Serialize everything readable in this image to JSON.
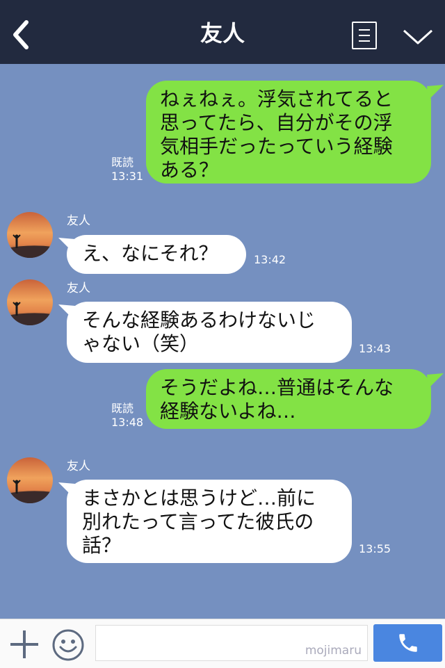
{
  "header": {
    "title": "友人"
  },
  "messages": [
    {
      "side": "me",
      "text": "ねぇねぇ。浮気されてると\n思ってたら、自分がその浮\n気相手だったっていう経験\nある？",
      "read": "既読",
      "time": "13:31"
    },
    {
      "side": "them",
      "name": "友人",
      "text": "え、なにそれ？",
      "time": "13:42"
    },
    {
      "side": "them",
      "name": "友人",
      "text": "そんな経験あるわけないじ\nゃない（笑）",
      "time": "13:43"
    },
    {
      "side": "me",
      "text": "そうだよね…普通はそんな\n経験ないよね…",
      "read": "既読",
      "time": "13:48"
    },
    {
      "side": "them",
      "name": "友人",
      "text": "まさかとは思うけど…前に\n別れたって言ってた彼氏の\n話？",
      "time": "13:55"
    }
  ],
  "footer": {
    "input_value": "",
    "watermark": "mojimaru"
  },
  "colors": {
    "header_bg": "#222a3f",
    "chat_bg": "#7590c0",
    "my_bubble": "#83e245",
    "their_bubble": "#ffffff",
    "call_button": "#4a86e0"
  },
  "icons": {
    "back": "back-arrow-icon",
    "menu": "menu-list-icon",
    "collapse": "chevron-down-icon",
    "add": "plus-icon",
    "sticker": "smiley-icon",
    "call": "phone-icon",
    "avatar": "sunset-silhouette-photo"
  }
}
